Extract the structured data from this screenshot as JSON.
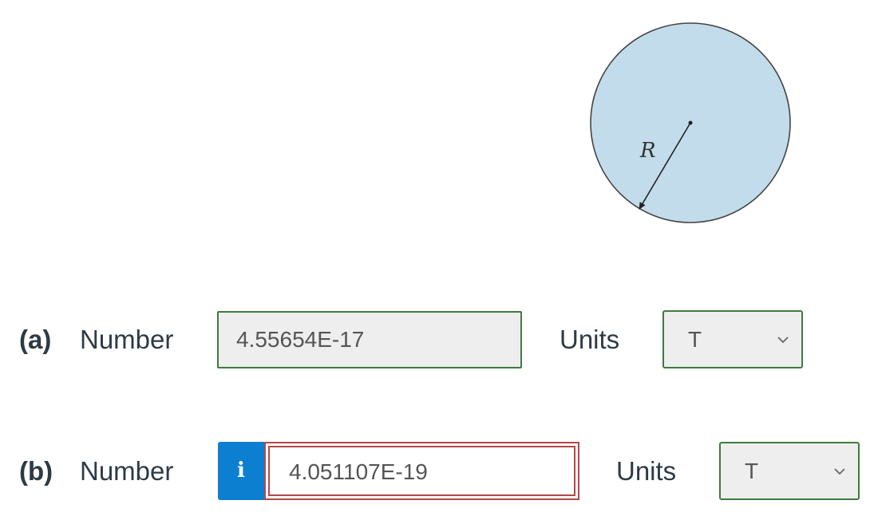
{
  "figure": {
    "radius_label": "R"
  },
  "parts": [
    {
      "label": "(a)",
      "number_label": "Number",
      "answer_value": "4.55654E-17",
      "units_label": "Units",
      "units_selected": "T"
    },
    {
      "label": "(b)",
      "info_icon": "i",
      "number_label": "Number",
      "answer_value": "4.051107E-19",
      "units_label": "Units",
      "units_selected": "T"
    }
  ],
  "colors": {
    "circle_fill": "#c2dceb",
    "correct_border": "#3f7a3f",
    "incorrect_border": "#b24848",
    "info_button": "#0c7fd1"
  }
}
